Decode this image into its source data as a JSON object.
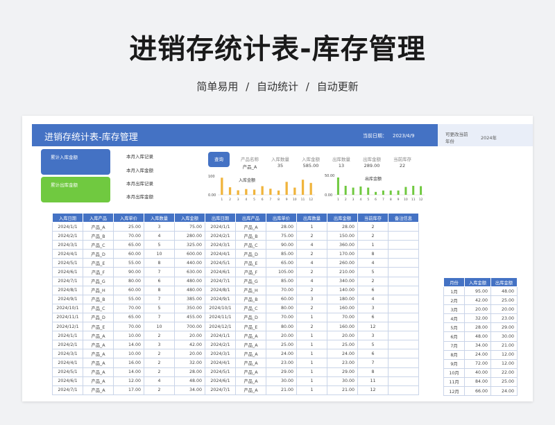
{
  "hero": {
    "title": "进销存统计表-库存管理",
    "subtitle": "简单易用   /   自动统计   /   自动更新"
  },
  "banner": {
    "title": "进销存统计表-库存管理",
    "date_label": "当前日期：",
    "date_value": "2023/4/9"
  },
  "side": {
    "note": "可更改当前年份",
    "year": "2024年"
  },
  "cards": {
    "in_total": "累计入库金额",
    "out_total": "累计出库金额"
  },
  "records": [
    "本月入库记录",
    "本月入库金额",
    "本月出库记录",
    "本月出库金额"
  ],
  "query": {
    "button": "查询",
    "headers": [
      "产品名称",
      "入库数量",
      "入库金额",
      "出库数量",
      "出库金额",
      "当前库存"
    ],
    "values": [
      "产品_A",
      "35",
      "585.00",
      "13",
      "289.00",
      "22"
    ]
  },
  "chart_data": [
    {
      "type": "bar",
      "title": "入库金额",
      "categories": [
        "1",
        "2",
        "3",
        "4",
        "5",
        "6",
        "7",
        "8",
        "9",
        "10",
        "11",
        "12"
      ],
      "values": [
        95,
        42,
        25,
        32,
        29,
        48,
        34,
        24,
        72,
        40,
        84,
        66
      ],
      "color": "#f0b43c",
      "y_tick_labels": [
        "100",
        "0.00"
      ],
      "ylim": [
        0,
        100
      ]
    },
    {
      "type": "bar",
      "title": "出库金额",
      "categories": [
        "1",
        "2",
        "3",
        "4",
        "5",
        "6",
        "7",
        "8",
        "9",
        "10",
        "11",
        "12"
      ],
      "values": [
        48,
        25,
        20,
        23,
        20,
        8,
        12,
        12,
        12,
        22,
        25,
        24
      ],
      "color": "#70c940",
      "y_tick_labels": [
        "50.00",
        "0.00"
      ],
      "ylim": [
        0,
        50
      ]
    }
  ],
  "table": {
    "headers": [
      "入库日期",
      "入库产品",
      "入库单价",
      "入库数量",
      "入库金额",
      "出库日期",
      "出库产品",
      "出库单价",
      "出库数量",
      "出库金额",
      "当前库存",
      "备注信息"
    ],
    "rows": [
      [
        "2024/1/1",
        "产品_A",
        "25.00",
        "3",
        "75.00",
        "2024/1/1",
        "产品_A",
        "28.00",
        "1",
        "28.00",
        "2",
        ""
      ],
      [
        "2024/2/1",
        "产品_B",
        "70.00",
        "4",
        "280.00",
        "2024/2/1",
        "产品_B",
        "75.00",
        "2",
        "150.00",
        "2",
        ""
      ],
      [
        "2024/3/1",
        "产品_C",
        "65.00",
        "5",
        "325.00",
        "2024/3/1",
        "产品_C",
        "90.00",
        "4",
        "360.00",
        "1",
        ""
      ],
      [
        "2024/4/1",
        "产品_D",
        "60.00",
        "10",
        "600.00",
        "2024/4/1",
        "产品_D",
        "85.00",
        "2",
        "170.00",
        "8",
        ""
      ],
      [
        "2024/5/1",
        "产品_E",
        "55.00",
        "8",
        "440.00",
        "2024/5/1",
        "产品_E",
        "65.00",
        "4",
        "260.00",
        "4",
        ""
      ],
      [
        "2024/6/1",
        "产品_F",
        "90.00",
        "7",
        "630.00",
        "2024/6/1",
        "产品_F",
        "105.00",
        "2",
        "210.00",
        "5",
        ""
      ],
      [
        "2024/7/1",
        "产品_G",
        "80.00",
        "6",
        "480.00",
        "2024/7/1",
        "产品_G",
        "85.00",
        "4",
        "340.00",
        "2",
        ""
      ],
      [
        "2024/8/1",
        "产品_H",
        "60.00",
        "8",
        "480.00",
        "2024/8/1",
        "产品_H",
        "70.00",
        "2",
        "140.00",
        "6",
        ""
      ],
      [
        "2024/9/1",
        "产品_B",
        "55.00",
        "7",
        "385.00",
        "2024/9/1",
        "产品_B",
        "60.00",
        "3",
        "180.00",
        "4",
        ""
      ],
      [
        "2024/10/1",
        "产品_C",
        "70.00",
        "5",
        "350.00",
        "2024/10/1",
        "产品_C",
        "80.00",
        "2",
        "160.00",
        "3",
        ""
      ],
      [
        "2024/11/1",
        "产品_D",
        "65.00",
        "7",
        "455.00",
        "2024/11/1",
        "产品_D",
        "70.00",
        "1",
        "70.00",
        "6",
        ""
      ],
      [
        "2024/12/1",
        "产品_E",
        "70.00",
        "10",
        "700.00",
        "2024/12/1",
        "产品_E",
        "80.00",
        "2",
        "160.00",
        "12",
        ""
      ],
      [
        "2024/1/1",
        "产品_A",
        "10.00",
        "2",
        "20.00",
        "2024/1/1",
        "产品_A",
        "20.00",
        "1",
        "20.00",
        "3",
        ""
      ],
      [
        "2024/2/1",
        "产品_A",
        "14.00",
        "3",
        "42.00",
        "2024/2/1",
        "产品_A",
        "25.00",
        "1",
        "25.00",
        "5",
        ""
      ],
      [
        "2024/3/1",
        "产品_A",
        "10.00",
        "2",
        "20.00",
        "2024/3/1",
        "产品_A",
        "24.00",
        "1",
        "24.00",
        "6",
        ""
      ],
      [
        "2024/4/1",
        "产品_A",
        "16.00",
        "2",
        "32.00",
        "2024/4/1",
        "产品_A",
        "23.00",
        "1",
        "23.00",
        "7",
        ""
      ],
      [
        "2024/5/1",
        "产品_A",
        "14.00",
        "2",
        "28.00",
        "2024/5/1",
        "产品_A",
        "29.00",
        "1",
        "29.00",
        "8",
        ""
      ],
      [
        "2024/6/1",
        "产品_A",
        "12.00",
        "4",
        "48.00",
        "2024/6/1",
        "产品_A",
        "30.00",
        "1",
        "30.00",
        "11",
        ""
      ],
      [
        "2024/7/1",
        "产品_A",
        "17.00",
        "2",
        "34.00",
        "2024/7/1",
        "产品_A",
        "21.00",
        "1",
        "21.00",
        "12",
        ""
      ]
    ]
  },
  "month_table": {
    "headers": [
      "月份",
      "入库金额",
      "出库金额"
    ],
    "rows": [
      [
        "1月",
        "95.00",
        "48.00"
      ],
      [
        "2月",
        "42.00",
        "25.00"
      ],
      [
        "3月",
        "20.00",
        "20.00"
      ],
      [
        "4月",
        "32.00",
        "23.00"
      ],
      [
        "5月",
        "28.00",
        "29.00"
      ],
      [
        "6月",
        "48.00",
        "30.00"
      ],
      [
        "7月",
        "34.00",
        "21.00"
      ],
      [
        "8月",
        "24.00",
        "12.00"
      ],
      [
        "9月",
        "72.00",
        "12.00"
      ],
      [
        "10月",
        "40.00",
        "22.00"
      ],
      [
        "11月",
        "84.00",
        "25.00"
      ],
      [
        "12月",
        "66.00",
        "24.00"
      ]
    ]
  }
}
